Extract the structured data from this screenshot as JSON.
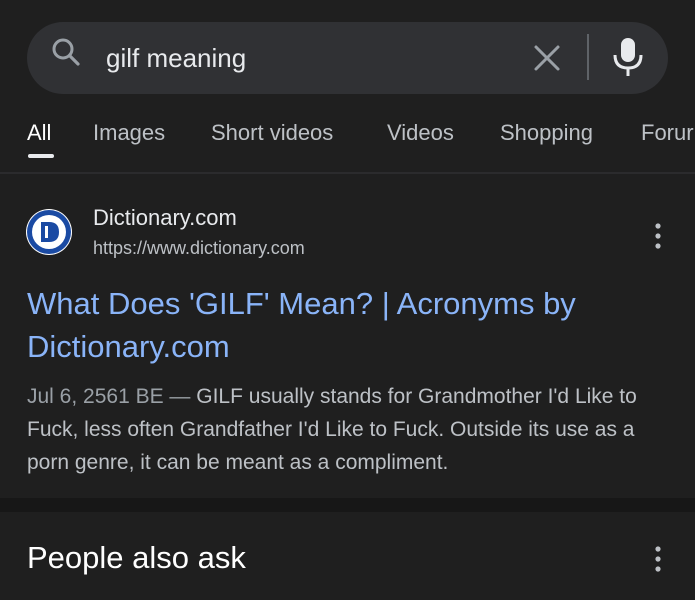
{
  "search": {
    "query": "gilf meaning",
    "icons": {
      "search": "search-icon",
      "clear": "close-icon",
      "voice": "mic-icon"
    }
  },
  "tabs": [
    {
      "label": "All",
      "active": true
    },
    {
      "label": "Images"
    },
    {
      "label": "Short videos"
    },
    {
      "label": "Videos"
    },
    {
      "label": "Shopping"
    },
    {
      "label": "Forur"
    }
  ],
  "result": {
    "site_name": "Dictionary.com",
    "site_url": "https://www.dictionary.com",
    "title_line1": "What Does 'GILF' Mean? | Acronyms by",
    "title_line2": "Dictionary.com",
    "snippet_date": "Jul 6, 2561 BE",
    "snippet_dash": " — ",
    "snippet_text": "GILF usually stands for Grandmother I'd Like to Fuck, less often Grandfather I'd Like to Fuck. Outside its use as a porn genre, it can be meant as a compliment."
  },
  "people_also_ask": {
    "title": "People also ask"
  },
  "colors": {
    "background": "#1f1f1f",
    "search_bar": "#303134",
    "link": "#8ab4f8",
    "logo_blue": "#1a4aa3"
  }
}
